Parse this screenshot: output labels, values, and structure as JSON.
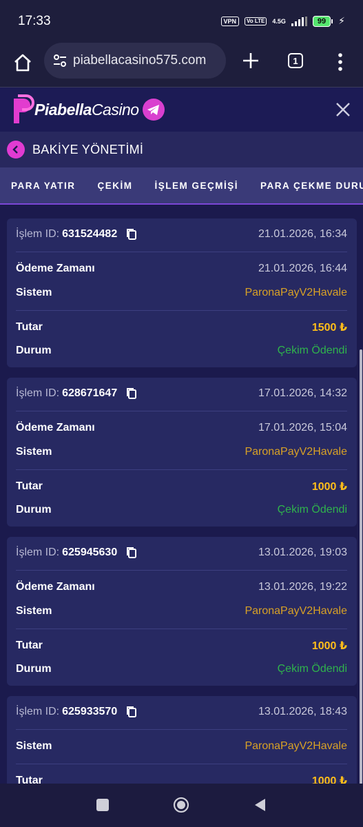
{
  "status_bar": {
    "time": "17:33",
    "vpn": "VPN",
    "volte": "Vo LTE",
    "network": "4.5G",
    "battery": "99"
  },
  "browser": {
    "url": "piabellacasino575.com",
    "tab_count": "1"
  },
  "header": {
    "logo_part1": "Piabella",
    "logo_part2": "Casino"
  },
  "section": {
    "title": "BAKİYE YÖNETİMİ"
  },
  "tabs": [
    {
      "label": "PARA YATIR"
    },
    {
      "label": "ÇEKİM"
    },
    {
      "label": "İŞLEM GEÇMİŞİ"
    },
    {
      "label": "PARA ÇEKME DURUMU"
    }
  ],
  "labels": {
    "id": "İşlem ID:",
    "payment_time": "Ödeme Zamanı",
    "system": "Sistem",
    "amount": "Tutar",
    "status": "Durum"
  },
  "transactions": [
    {
      "id": "631524482",
      "date": "21.01.2026, 16:34",
      "payment_time": "21.01.2026, 16:44",
      "system": "ParonaPayV2Havale",
      "amount": "1500 ₺",
      "status": "Çekim Ödendi"
    },
    {
      "id": "628671647",
      "date": "17.01.2026, 14:32",
      "payment_time": "17.01.2026, 15:04",
      "system": "ParonaPayV2Havale",
      "amount": "1000 ₺",
      "status": "Çekim Ödendi"
    },
    {
      "id": "625945630",
      "date": "13.01.2026, 19:03",
      "payment_time": "13.01.2026, 19:22",
      "system": "ParonaPayV2Havale",
      "amount": "1000 ₺",
      "status": "Çekim Ödendi"
    },
    {
      "id": "625933570",
      "date": "13.01.2026, 18:43",
      "system": "ParonaPayV2Havale",
      "amount": "1000 ₺"
    }
  ],
  "colors": {
    "system": "#d8a126",
    "amount": "#ffbe1a",
    "status": "#2fb34c",
    "accent": "#e03bd2"
  }
}
